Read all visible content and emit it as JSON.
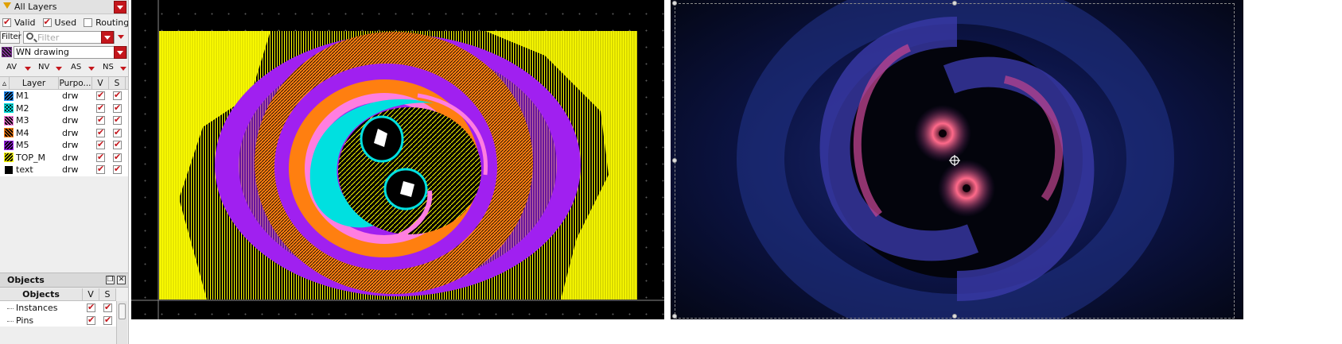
{
  "layer_panel": {
    "layer_filter": "All Layers",
    "visibility": [
      {
        "label": "Valid",
        "checked": true
      },
      {
        "label": "Used",
        "checked": true
      },
      {
        "label": "Routing",
        "checked": false
      }
    ],
    "filter_button": "Filter",
    "filter_placeholder": "Filter",
    "lpp_value": "WN drawing",
    "toggles": [
      "AV",
      "NV",
      "AS",
      "NS"
    ],
    "columns": {
      "layer": "Layer",
      "purpose": "Purpo...",
      "v": "V",
      "s": "S"
    },
    "layers": [
      {
        "name": "M1",
        "purpose": "drw",
        "v": true,
        "s": true,
        "color": "#1e90ff",
        "pattern": "back"
      },
      {
        "name": "M2",
        "purpose": "drw",
        "v": true,
        "s": true,
        "color": "#00e0e0",
        "pattern": "cross"
      },
      {
        "name": "M3",
        "purpose": "drw",
        "v": true,
        "s": true,
        "color": "#ff7ee0",
        "pattern": "fwd"
      },
      {
        "name": "M4",
        "purpose": "drw",
        "v": true,
        "s": true,
        "color": "#ff7f10",
        "pattern": "fwd"
      },
      {
        "name": "M5",
        "purpose": "drw",
        "v": true,
        "s": true,
        "color": "#a020f0",
        "pattern": "back"
      },
      {
        "name": "TOP_M",
        "purpose": "drw",
        "v": true,
        "s": true,
        "color": "#ffff00",
        "pattern": "back"
      },
      {
        "name": "text",
        "purpose": "drw",
        "v": true,
        "s": true,
        "color": "#ffffff",
        "pattern": "none"
      }
    ]
  },
  "objects_panel": {
    "title": "Objects",
    "columns": {
      "object": "Objects",
      "v": "V",
      "s": "S"
    },
    "items": [
      {
        "name": "Instances",
        "v": true,
        "s": true
      },
      {
        "name": "Pins",
        "v": true,
        "s": true
      }
    ]
  }
}
